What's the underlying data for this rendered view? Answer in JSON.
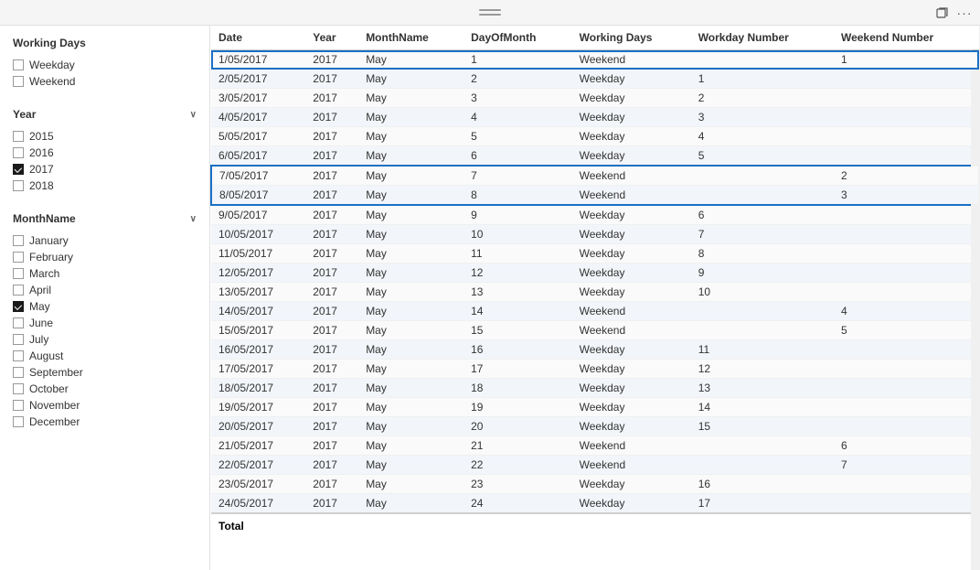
{
  "titlebar": {
    "drag_label": "drag handle",
    "btn_expand": "⧉",
    "btn_more": "···"
  },
  "left_panel": {
    "sections": [
      {
        "id": "working-days",
        "label": "Working Days",
        "has_chevron": false,
        "items": [
          {
            "id": "weekday",
            "label": "Weekday",
            "checked": false
          },
          {
            "id": "weekend",
            "label": "Weekend",
            "checked": false
          }
        ]
      },
      {
        "id": "year",
        "label": "Year",
        "has_chevron": true,
        "items": [
          {
            "id": "y2015",
            "label": "2015",
            "checked": false
          },
          {
            "id": "y2016",
            "label": "2016",
            "checked": false
          },
          {
            "id": "y2017",
            "label": "2017",
            "checked": true
          },
          {
            "id": "y2018",
            "label": "2018",
            "checked": false
          }
        ]
      },
      {
        "id": "monthname",
        "label": "MonthName",
        "has_chevron": true,
        "items": [
          {
            "id": "jan",
            "label": "January",
            "checked": false
          },
          {
            "id": "feb",
            "label": "February",
            "checked": false
          },
          {
            "id": "mar",
            "label": "March",
            "checked": false
          },
          {
            "id": "apr",
            "label": "April",
            "checked": false
          },
          {
            "id": "may",
            "label": "May",
            "checked": true
          },
          {
            "id": "jun",
            "label": "June",
            "checked": false
          },
          {
            "id": "jul",
            "label": "July",
            "checked": false
          },
          {
            "id": "aug",
            "label": "August",
            "checked": false
          },
          {
            "id": "sep",
            "label": "September",
            "checked": false
          },
          {
            "id": "oct",
            "label": "October",
            "checked": false
          },
          {
            "id": "nov",
            "label": "November",
            "checked": false
          },
          {
            "id": "dec",
            "label": "December",
            "checked": false
          }
        ]
      }
    ]
  },
  "table": {
    "columns": [
      "Date",
      "Year",
      "MonthName",
      "DayOfMonth",
      "Working Days",
      "Workday Number",
      "Weekend Number"
    ],
    "rows": [
      {
        "date": "1/05/2017",
        "year": "2017",
        "month": "May",
        "day": "1",
        "workingDays": "Weekend",
        "workdayNum": "",
        "weekendNum": "1",
        "selected": true
      },
      {
        "date": "2/05/2017",
        "year": "2017",
        "month": "May",
        "day": "2",
        "workingDays": "Weekday",
        "workdayNum": "1",
        "weekendNum": "",
        "selected": false
      },
      {
        "date": "3/05/2017",
        "year": "2017",
        "month": "May",
        "day": "3",
        "workingDays": "Weekday",
        "workdayNum": "2",
        "weekendNum": "",
        "selected": false
      },
      {
        "date": "4/05/2017",
        "year": "2017",
        "month": "May",
        "day": "4",
        "workingDays": "Weekday",
        "workdayNum": "3",
        "weekendNum": "",
        "selected": false
      },
      {
        "date": "5/05/2017",
        "year": "2017",
        "month": "May",
        "day": "5",
        "workingDays": "Weekday",
        "workdayNum": "4",
        "weekendNum": "",
        "selected": false
      },
      {
        "date": "6/05/2017",
        "year": "2017",
        "month": "May",
        "day": "6",
        "workingDays": "Weekday",
        "workdayNum": "5",
        "weekendNum": "",
        "selected": false
      },
      {
        "date": "7/05/2017",
        "year": "2017",
        "month": "May",
        "day": "7",
        "workingDays": "Weekend",
        "workdayNum": "",
        "weekendNum": "2",
        "selected": true
      },
      {
        "date": "8/05/2017",
        "year": "2017",
        "month": "May",
        "day": "8",
        "workingDays": "Weekend",
        "workdayNum": "",
        "weekendNum": "3",
        "selected": true
      },
      {
        "date": "9/05/2017",
        "year": "2017",
        "month": "May",
        "day": "9",
        "workingDays": "Weekday",
        "workdayNum": "6",
        "weekendNum": "",
        "selected": false
      },
      {
        "date": "10/05/2017",
        "year": "2017",
        "month": "May",
        "day": "10",
        "workingDays": "Weekday",
        "workdayNum": "7",
        "weekendNum": "",
        "selected": false
      },
      {
        "date": "11/05/2017",
        "year": "2017",
        "month": "May",
        "day": "11",
        "workingDays": "Weekday",
        "workdayNum": "8",
        "weekendNum": "",
        "selected": false
      },
      {
        "date": "12/05/2017",
        "year": "2017",
        "month": "May",
        "day": "12",
        "workingDays": "Weekday",
        "workdayNum": "9",
        "weekendNum": "",
        "selected": false
      },
      {
        "date": "13/05/2017",
        "year": "2017",
        "month": "May",
        "day": "13",
        "workingDays": "Weekday",
        "workdayNum": "10",
        "weekendNum": "",
        "selected": false
      },
      {
        "date": "14/05/2017",
        "year": "2017",
        "month": "May",
        "day": "14",
        "workingDays": "Weekend",
        "workdayNum": "",
        "weekendNum": "4",
        "selected": false
      },
      {
        "date": "15/05/2017",
        "year": "2017",
        "month": "May",
        "day": "15",
        "workingDays": "Weekend",
        "workdayNum": "",
        "weekendNum": "5",
        "selected": false
      },
      {
        "date": "16/05/2017",
        "year": "2017",
        "month": "May",
        "day": "16",
        "workingDays": "Weekday",
        "workdayNum": "11",
        "weekendNum": "",
        "selected": false
      },
      {
        "date": "17/05/2017",
        "year": "2017",
        "month": "May",
        "day": "17",
        "workingDays": "Weekday",
        "workdayNum": "12",
        "weekendNum": "",
        "selected": false
      },
      {
        "date": "18/05/2017",
        "year": "2017",
        "month": "May",
        "day": "18",
        "workingDays": "Weekday",
        "workdayNum": "13",
        "weekendNum": "",
        "selected": false
      },
      {
        "date": "19/05/2017",
        "year": "2017",
        "month": "May",
        "day": "19",
        "workingDays": "Weekday",
        "workdayNum": "14",
        "weekendNum": "",
        "selected": false
      },
      {
        "date": "20/05/2017",
        "year": "2017",
        "month": "May",
        "day": "20",
        "workingDays": "Weekday",
        "workdayNum": "15",
        "weekendNum": "",
        "selected": false
      },
      {
        "date": "21/05/2017",
        "year": "2017",
        "month": "May",
        "day": "21",
        "workingDays": "Weekend",
        "workdayNum": "",
        "weekendNum": "6",
        "selected": false
      },
      {
        "date": "22/05/2017",
        "year": "2017",
        "month": "May",
        "day": "22",
        "workingDays": "Weekend",
        "workdayNum": "",
        "weekendNum": "7",
        "selected": false
      },
      {
        "date": "23/05/2017",
        "year": "2017",
        "month": "May",
        "day": "23",
        "workingDays": "Weekday",
        "workdayNum": "16",
        "weekendNum": "",
        "selected": false
      },
      {
        "date": "24/05/2017",
        "year": "2017",
        "month": "May",
        "day": "24",
        "workingDays": "Weekday",
        "workdayNum": "17",
        "weekendNum": "",
        "selected": false
      }
    ],
    "footer_label": "Total"
  }
}
